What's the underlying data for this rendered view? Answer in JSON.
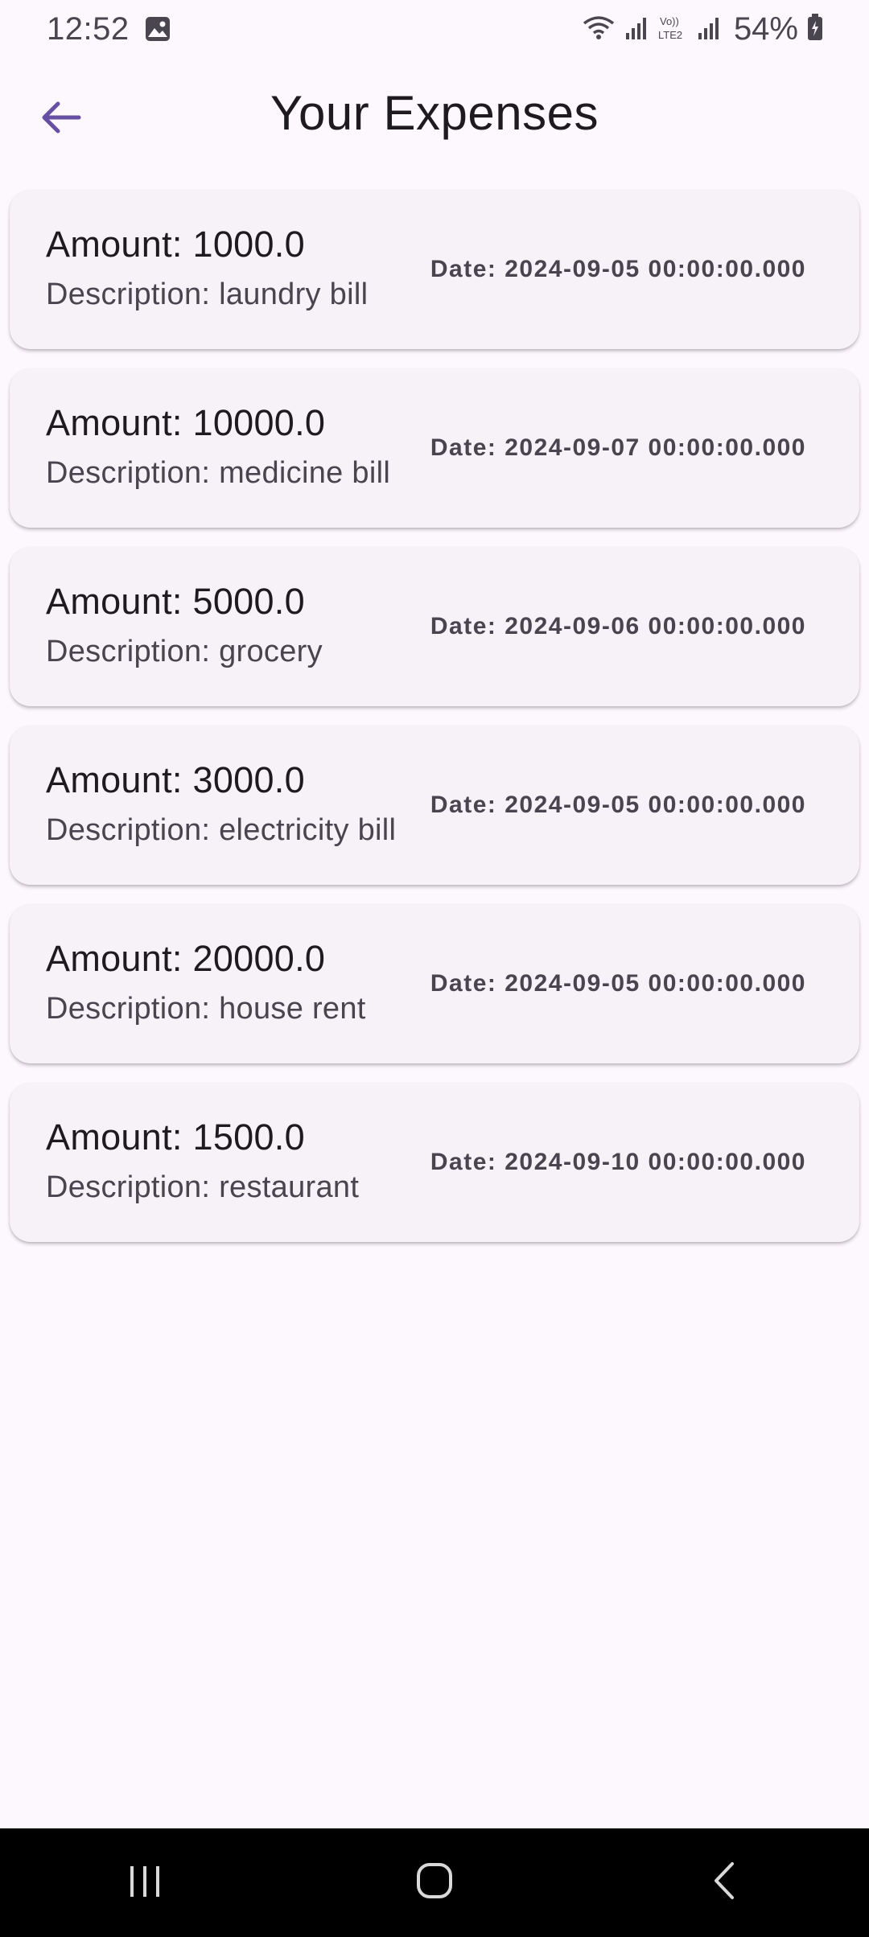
{
  "status_bar": {
    "time": "12:52",
    "battery_percent": "54%",
    "icons": [
      "gallery-icon",
      "wifi-icon",
      "signal-icon",
      "volte-icon",
      "signal-icon",
      "battery-icon"
    ]
  },
  "app_bar": {
    "back_icon": "arrow-left-icon",
    "title": "Your Expenses"
  },
  "expenses": [
    {
      "amount": "Amount: 1000.0",
      "description": "Description: laundry bill",
      "date": "Date: 2024-09-05 00:00:00.000"
    },
    {
      "amount": "Amount: 10000.0",
      "description": "Description: medicine bill",
      "date": "Date: 2024-09-07 00:00:00.000"
    },
    {
      "amount": "Amount: 5000.0",
      "description": "Description: grocery",
      "date": "Date: 2024-09-06 00:00:00.000"
    },
    {
      "amount": "Amount: 3000.0",
      "description": "Description: electricity bill",
      "date": "Date: 2024-09-05 00:00:00.000"
    },
    {
      "amount": "Amount: 20000.0",
      "description": "Description: house rent",
      "date": "Date: 2024-09-05 00:00:00.000"
    },
    {
      "amount": "Amount: 1500.0",
      "description": "Description: restaurant",
      "date": "Date: 2024-09-10 00:00:00.000"
    }
  ],
  "nav_bar": {
    "buttons": [
      "recents-icon",
      "home-icon",
      "back-icon"
    ]
  },
  "colors": {
    "background": "#fdf7fe",
    "card": "#f7f1f8",
    "accent": "#6750a4",
    "nav_bar": "#000000"
  }
}
